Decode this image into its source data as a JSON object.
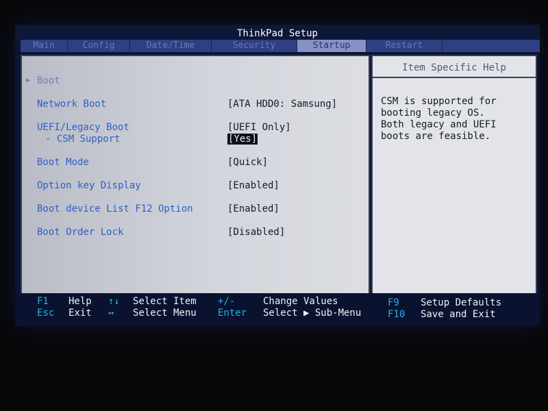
{
  "title": "ThinkPad Setup",
  "menu": {
    "tabs": [
      {
        "label": "Main"
      },
      {
        "label": "Config"
      },
      {
        "label": "Date/Time"
      },
      {
        "label": "Security"
      },
      {
        "label": "Startup"
      },
      {
        "label": "Restart"
      }
    ],
    "active": "Startup"
  },
  "boot_item": {
    "label": "Boot"
  },
  "settings": [
    {
      "label": "Network Boot",
      "value": "[ATA HDD0: Samsung]"
    },
    {
      "label": "UEFI/Legacy Boot",
      "value": "[UEFI Only]"
    },
    {
      "label": "- CSM Support",
      "value": "[Yes]",
      "selected": true
    },
    {
      "label": "Boot Mode",
      "value": "[Quick]"
    },
    {
      "label": "Option key Display",
      "value": "[Enabled]"
    },
    {
      "label": "Boot device List F12 Option",
      "value": "[Enabled]"
    },
    {
      "label": "Boot Order Lock",
      "value": "[Disabled]"
    }
  ],
  "help": {
    "title": "Item Specific Help",
    "text": "CSM is supported for\nbooting legacy OS.\nBoth legacy and UEFI\nboots are feasible."
  },
  "footer": {
    "f1_key": "F1",
    "f1_desc": "Help",
    "esc_key": "Esc",
    "esc_desc": "Exit",
    "updown_key": "↑↓",
    "updown_desc": "Select Item",
    "leftright_key": "↔",
    "leftright_desc": "Select Menu",
    "plusminus_key": "+/-",
    "plusminus_desc": "Change Values",
    "enter_key": "Enter",
    "enter_desc": "Select ▶ Sub-Menu",
    "f9_key": "F9",
    "f9_desc": "Setup Defaults",
    "f10_key": "F10",
    "f10_desc": "Save and Exit"
  },
  "colors": {
    "background": "#0b1433",
    "content_panel": "#d3d5dc",
    "label_blue": "#2f5ec6",
    "footer_key": "#22b3ea"
  }
}
